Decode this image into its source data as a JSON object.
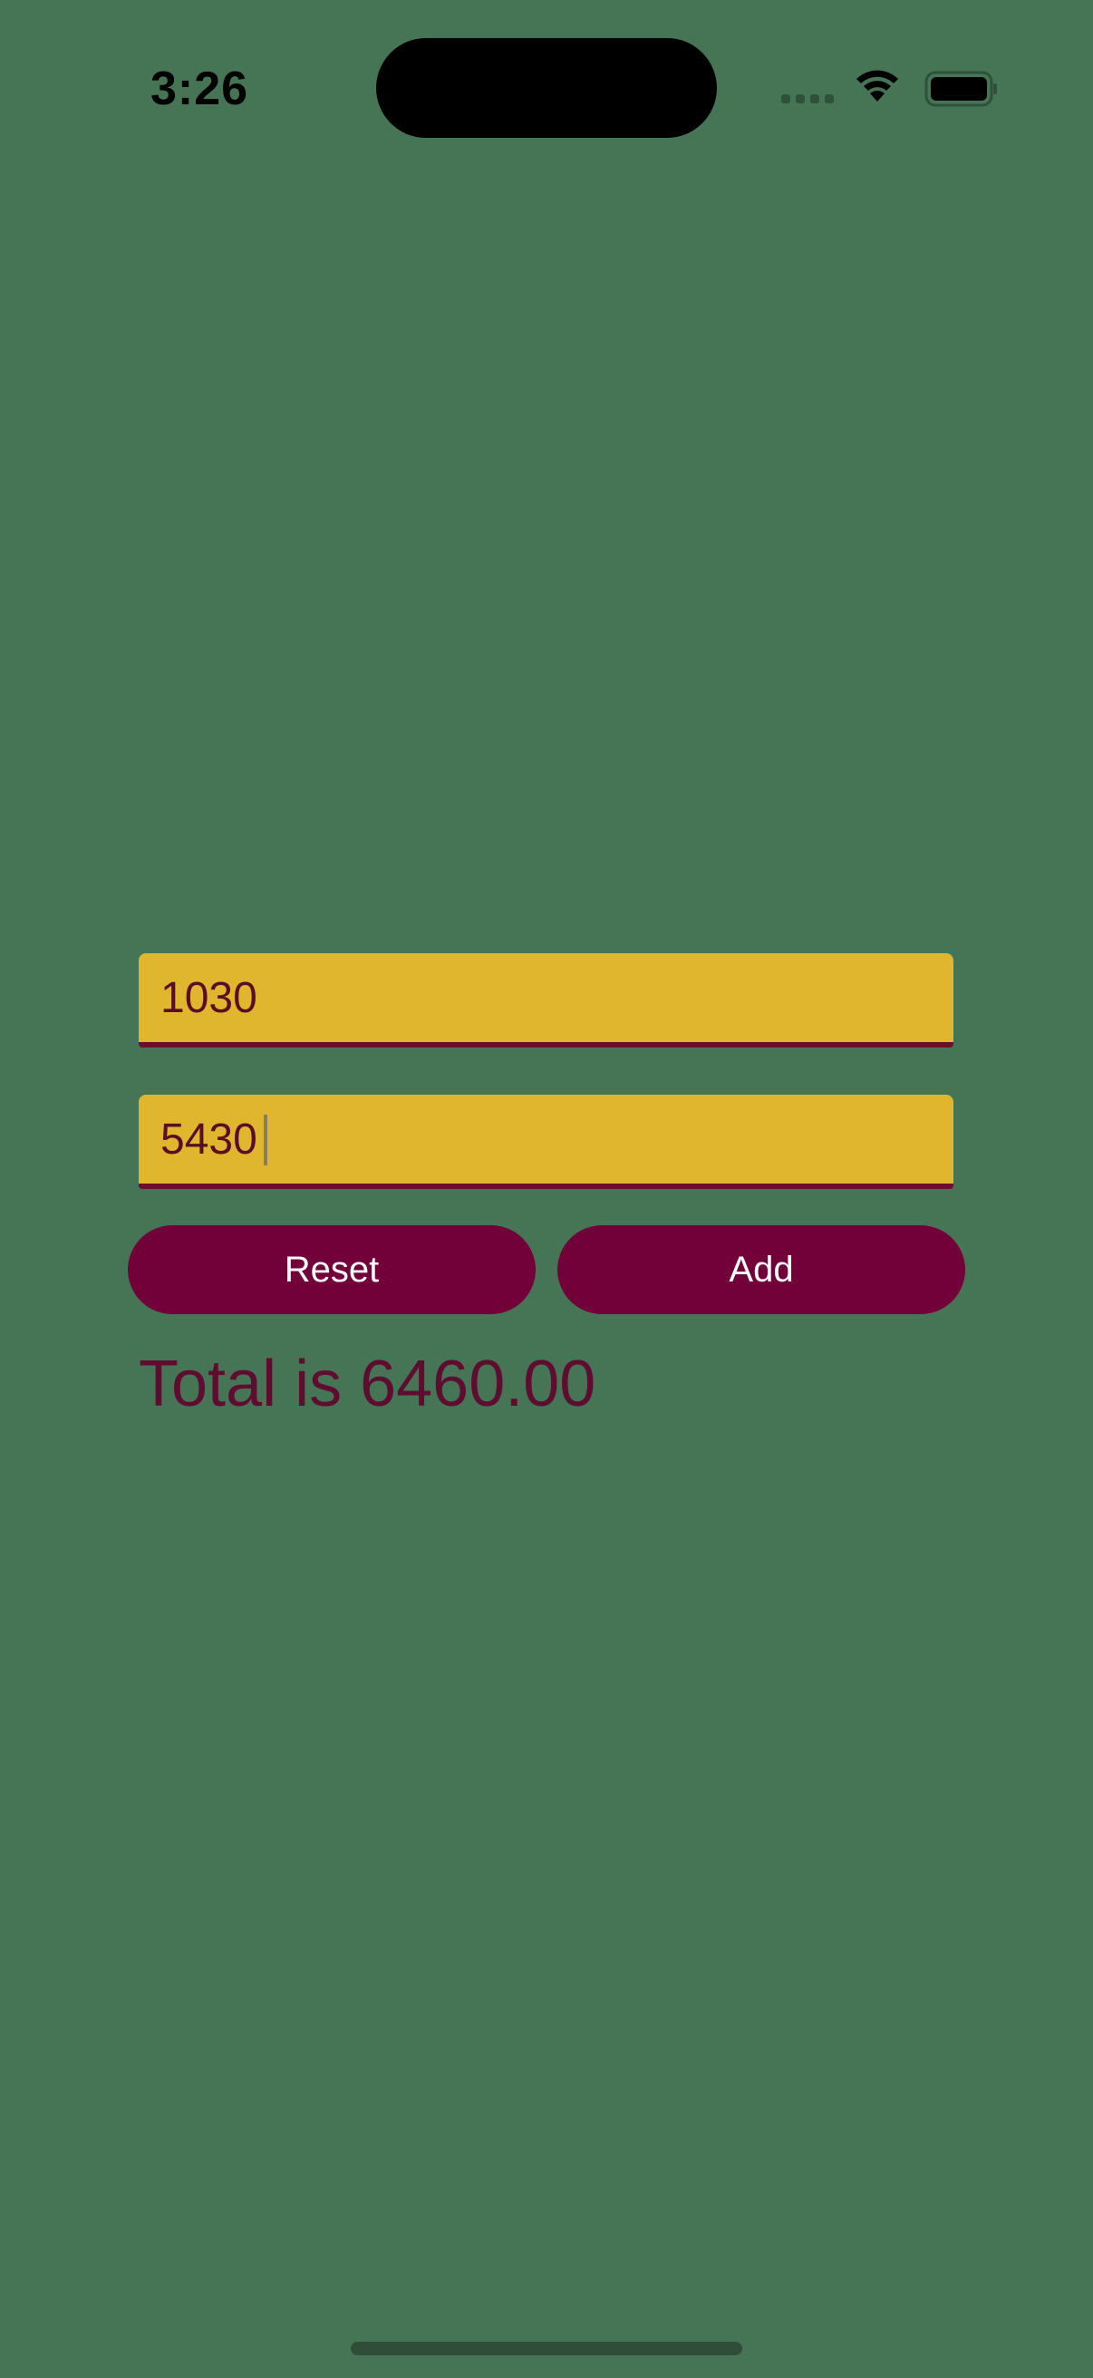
{
  "status_bar": {
    "time": "3:26"
  },
  "form": {
    "first_value": "1030",
    "second_value": "5430",
    "reset_label": "Reset",
    "add_label": "Add",
    "total_text": "Total is 6460.00"
  },
  "colors": {
    "background": "#467556",
    "field": "#e0b62f",
    "button": "#720139",
    "text_accent": "#5e0d31"
  },
  "icons": {
    "wifi": "wifi-icon",
    "battery": "battery-icon",
    "signal": "cellular-signal-icon"
  }
}
